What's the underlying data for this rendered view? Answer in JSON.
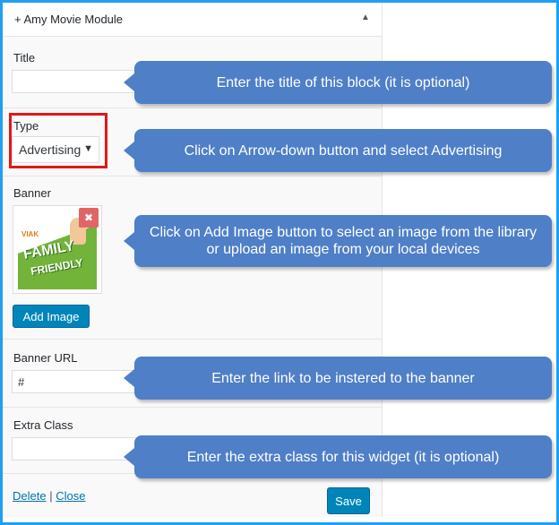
{
  "widget": {
    "title": "+ Amy Movie Module",
    "collapse_icon": "▲"
  },
  "fields": {
    "title_label": "Title",
    "title_value": "",
    "type_label": "Type",
    "type_value": "Advertising",
    "type_caret": "▼",
    "banner_label": "Banner",
    "banner_image_logo": "VIAK",
    "banner_image_line1": "FAMILY",
    "banner_image_line2": "FRIENDLY",
    "remove_icon": "✖",
    "add_image_label": "Add Image",
    "banner_url_label": "Banner URL",
    "banner_url_value": "#",
    "extra_class_label": "Extra Class",
    "extra_class_value": ""
  },
  "footer": {
    "delete_label": "Delete",
    "separator": "|",
    "close_label": "Close",
    "save_label": "Save"
  },
  "callouts": {
    "title": "Enter the title of this block (it is optional)",
    "type": "Click on Arrow-down button and select Advertising",
    "banner": "Click on Add Image button to select an image from the library or upload an image from your local devices",
    "banner_url": "Enter the link to be instered to the banner",
    "extra_class": "Enter the extra class for this widget (it is optional)"
  },
  "colors": {
    "frame_border": "#1f9ff0",
    "callout_bg": "#4f7fc7",
    "primary_button": "#0085ba",
    "highlight_border": "#e01818"
  }
}
